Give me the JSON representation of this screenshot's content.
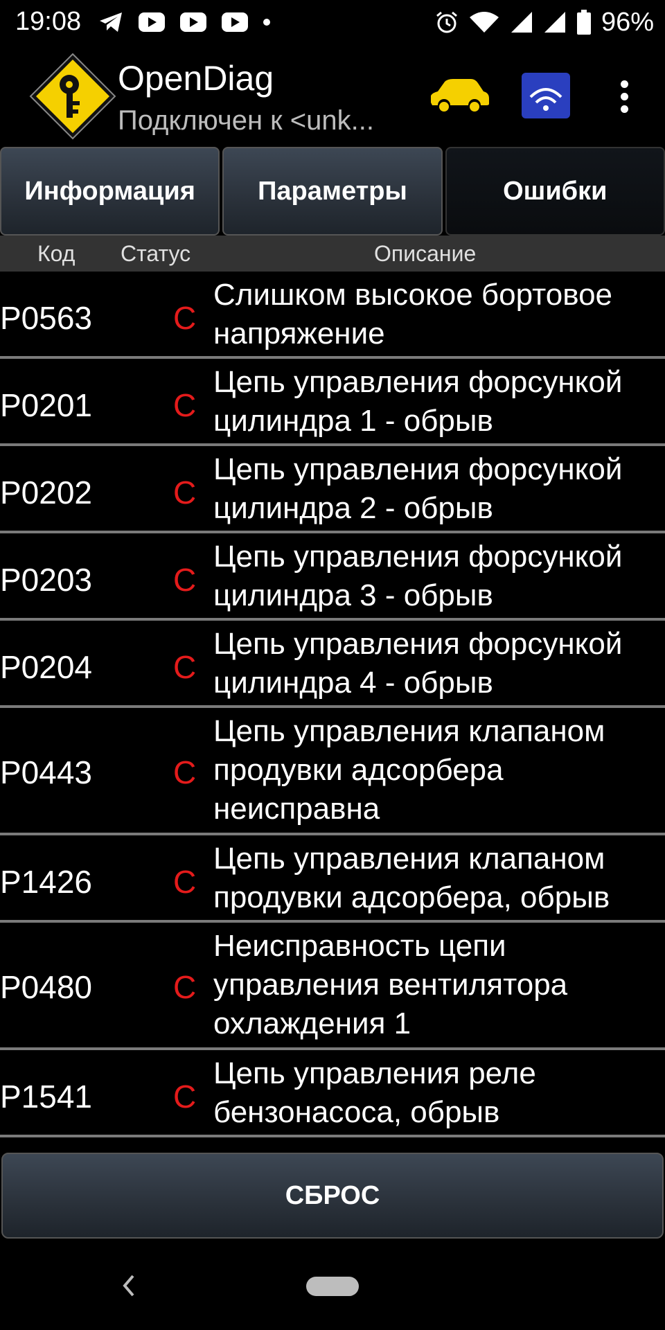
{
  "status_bar": {
    "time": "19:08",
    "battery": "96%",
    "left_icons": [
      "telegram-icon",
      "youtube-icon",
      "youtube-icon",
      "youtube-icon",
      "dot-icon"
    ],
    "right_icons": [
      "alarm-icon",
      "wifi-icon",
      "signal-icon",
      "signal-icon",
      "battery-icon"
    ]
  },
  "app": {
    "title": "OpenDiag",
    "subtitle": "Подключен к <unk...",
    "icons": [
      "app-logo-icon",
      "car-icon",
      "elm327-wifi-icon",
      "more-vert-icon"
    ],
    "accent_color": "#f5d000"
  },
  "tabs": [
    {
      "label": "Информация",
      "active": false
    },
    {
      "label": "Параметры",
      "active": false
    },
    {
      "label": "Ошибки",
      "active": true
    }
  ],
  "columns": {
    "code": "Код",
    "status": "Статус",
    "description": "Описание"
  },
  "errors": [
    {
      "code": "P0563",
      "status": "C",
      "description": "Слишком высокое бортовое напряжение"
    },
    {
      "code": "P0201",
      "status": "C",
      "description": "Цепь управления форсункой цилиндра 1 - обрыв"
    },
    {
      "code": "P0202",
      "status": "C",
      "description": "Цепь управления форсункой цилиндра 2 - обрыв"
    },
    {
      "code": "P0203",
      "status": "C",
      "description": "Цепь управления форсункой цилиндра 3 - обрыв"
    },
    {
      "code": "P0204",
      "status": "C",
      "description": "Цепь управления форсункой цилиндра 4 - обрыв"
    },
    {
      "code": "P0443",
      "status": "C",
      "description": "Цепь управления клапаном продувки адсорбера неисправна"
    },
    {
      "code": "P1426",
      "status": "C",
      "description": "Цепь управления клапаном продувки адсорбера, обрыв"
    },
    {
      "code": "P0480",
      "status": "C",
      "description": "Неисправность цепи управления вентилятора охлаждения 1"
    },
    {
      "code": "P1541",
      "status": "C",
      "description": "Цепь управления реле бензонасоса, обрыв"
    }
  ],
  "status_color": "#e41b1b",
  "reset_label": "СБРОС",
  "nav": {
    "icons": [
      "back-icon",
      "home-pill-icon"
    ]
  }
}
